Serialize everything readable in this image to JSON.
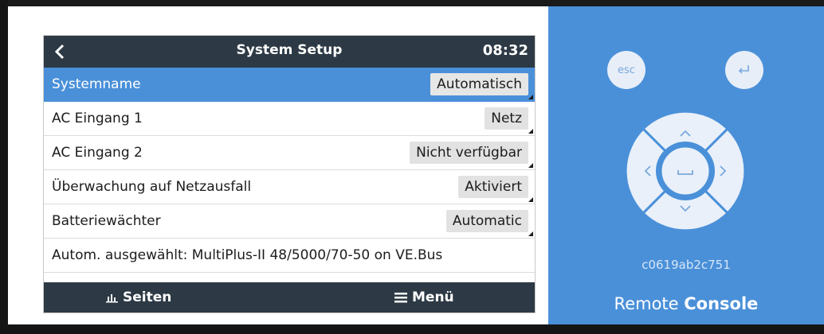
{
  "header": {
    "title": "System Setup",
    "time": "08:32"
  },
  "menu_rows": [
    {
      "label": "Systemname",
      "value": "Automatisch",
      "selected": true
    },
    {
      "label": "AC Eingang 1",
      "value": "Netz",
      "selected": false
    },
    {
      "label": "AC Eingang 2",
      "value": "Nicht verfügbar",
      "selected": false
    },
    {
      "label": "Überwachung auf Netzausfall",
      "value": "Aktiviert",
      "selected": false
    },
    {
      "label": "Batteriewächter",
      "value": "Automatic",
      "selected": false
    },
    {
      "label": "Autom. ausgewählt: MultiPlus-II 48/5000/70-50 on VE.Bus",
      "value": null,
      "selected": false
    }
  ],
  "footer": {
    "pages_label": "Seiten",
    "menu_label": "Menü"
  },
  "remote": {
    "esc_label": "esc",
    "device_id": "c0619ab2c751",
    "title_light": "Remote",
    "title_bold": "Console"
  },
  "colors": {
    "header_bg": "#2d3a45",
    "accent_blue": "#4a90d9",
    "value_box": "#e2e2e2"
  },
  "icons": {
    "back": "chevron-left-icon",
    "pages": "bar-chart-icon",
    "menu": "hamburger-icon",
    "enter": "enter-return-icon",
    "dpad": [
      "chevron-up-icon",
      "chevron-down-icon",
      "chevron-left-icon",
      "chevron-right-icon",
      "space-icon"
    ]
  }
}
